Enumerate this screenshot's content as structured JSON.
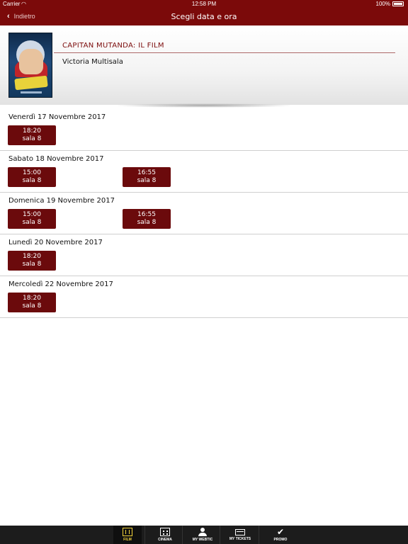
{
  "status_bar": {
    "carrier": "Carrier",
    "time": "12:58 PM",
    "battery": "100%"
  },
  "nav": {
    "back_label": "Indietro",
    "title": "Scegli data e ora"
  },
  "movie": {
    "title": "CAPITAN MUTANDA: IL FILM",
    "cinema": "Victoria Multisala"
  },
  "days": [
    {
      "label": "Venerdì 17 Novembre 2017",
      "slots": [
        {
          "time": "18:20",
          "room": "sala 8"
        }
      ]
    },
    {
      "label": "Sabato 18 Novembre 2017",
      "slots": [
        {
          "time": "15:00",
          "room": "sala 8"
        },
        {
          "time": "16:55",
          "room": "sala 8"
        }
      ]
    },
    {
      "label": "Domenica 19 Novembre 2017",
      "slots": [
        {
          "time": "15:00",
          "room": "sala 8"
        },
        {
          "time": "16:55",
          "room": "sala 8"
        }
      ]
    },
    {
      "label": "Lunedì 20 Novembre 2017",
      "slots": [
        {
          "time": "18:20",
          "room": "sala 8"
        }
      ]
    },
    {
      "label": "Mercoledì 22 Novembre 2017",
      "slots": [
        {
          "time": "18:20",
          "room": "sala 8"
        }
      ]
    }
  ],
  "tabs": [
    {
      "label": "FILM",
      "icon": "film-icon",
      "active": true
    },
    {
      "label": "CINEMA",
      "icon": "building-icon",
      "active": false
    },
    {
      "label": "MY WEBTIC",
      "icon": "user-icon",
      "active": false
    },
    {
      "label": "MY TICKETS",
      "icon": "ticket-icon",
      "active": false
    },
    {
      "label": "PROMO",
      "icon": "check-icon",
      "active": false
    }
  ],
  "colors": {
    "brand": "#7b0a0a",
    "slot": "#6b0a0c",
    "active_tab": "#f2d23a",
    "tab_bar": "#1c1c1c"
  }
}
